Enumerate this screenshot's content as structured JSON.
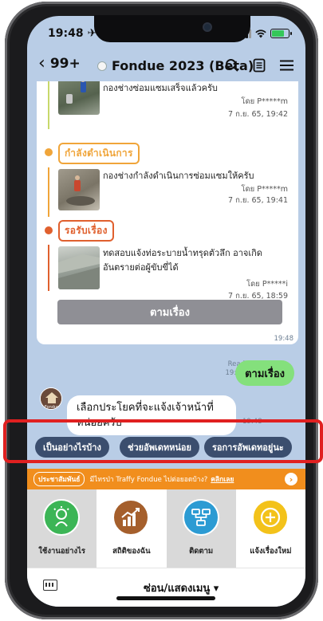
{
  "status_bar": {
    "time": "19:48 ✈︎"
  },
  "header": {
    "back_count": "99+",
    "title": "Fondue 2023 (Beta)",
    "icons": [
      "search-icon",
      "notes-icon",
      "menu-icon"
    ]
  },
  "timeline": {
    "entries": [
      {
        "message": "กองช่างซ่อมแซมเสร็จแล้วครับ",
        "by": "โดย P*****m",
        "when": "7 ก.ย. 65, 19:42"
      },
      {
        "message": "กองช่างกำลังดำเนินการซ่อมแซมให้ครับ",
        "by": "โดย P*****m",
        "when": "7 ก.ย. 65, 19:41"
      },
      {
        "message": "ทดสอบแจ้งท่อระบายน้ำทรุดตัวลึก อาจเกิดอันตรายต่อผู้ขับขี่ได้",
        "by": "โดย P*****i",
        "when": "7 ก.ย. 65, 18:59"
      }
    ],
    "stages": [
      {
        "label": "กำลังดำเนินการ",
        "color": "#f0a53a"
      },
      {
        "label": "รอรับเรื่อง",
        "color": "#e0602e"
      }
    ],
    "follow_button": "ตามเรื่อง",
    "card_time": "19:48"
  },
  "sent": {
    "read": "Read",
    "time": "19:48",
    "text": "ตามเรื่อง"
  },
  "received": {
    "text": "เลือกประโยคที่จะแจ้งเจ้าหน้าที่หน่อยครับ",
    "time": "19:48",
    "avatar_caption": "Fondue"
  },
  "quick_replies": [
    "เป็นอย่างไรบ้าง",
    "ช่วยอัพเดทหน่อย",
    "รอการอัพเดทอยู่นะ"
  ],
  "promo": {
    "pill": "ประชาสัมพันธ์",
    "text": "มีไทรป่า Traffy Fondue ไปต่อยอดบ้าง?",
    "link": "คลิกเลย"
  },
  "menu": [
    {
      "label": "ใช้งานอย่างไร",
      "icon": "idea-person-icon",
      "color": "#3cb556"
    },
    {
      "label": "สถิติของฉัน",
      "icon": "chart-icon",
      "color": "#a55f2c"
    },
    {
      "label": "ติดตาม",
      "icon": "flowchart-icon",
      "color": "#2c9bd3"
    },
    {
      "label": "แจ้งเรื่องใหม่",
      "icon": "add-circle-icon",
      "color": "#f3c21a"
    }
  ],
  "bottom_bar": {
    "toggle": "ซ่อน/แสดงเมนู ▾"
  },
  "colors": {
    "chat_bg": "#b9cde6",
    "sent_bubble": "#84e07c",
    "quick_reply": "#3b4e6e",
    "promo": "#f18e1d",
    "highlight": "#e02020"
  }
}
